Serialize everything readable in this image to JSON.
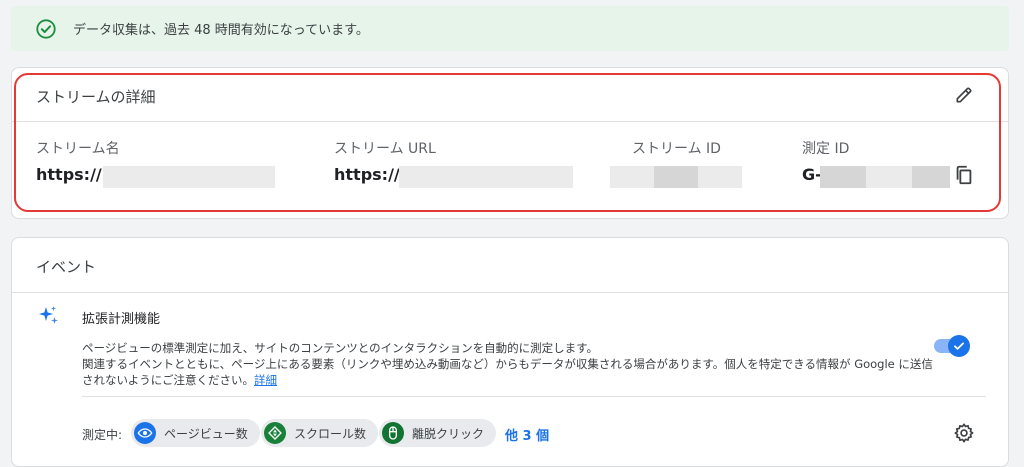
{
  "banner": {
    "message": "データ収集は、過去 48 時間有効になっています。",
    "icon": "check-circle-icon",
    "color": "#1e8e3e"
  },
  "stream_details": {
    "title": "ストリームの詳細",
    "edit_icon": "pencil-icon",
    "fields": {
      "name": {
        "label": "ストリーム名",
        "value": "https://"
      },
      "url": {
        "label": "ストリーム URL",
        "value": "https://"
      },
      "id": {
        "label": "ストリーム ID",
        "value": ""
      },
      "measurement_id": {
        "label": "測定 ID",
        "value": "G-"
      }
    },
    "copy_icon": "copy-icon",
    "highlight_color": "#e53935"
  },
  "events": {
    "title": "イベント",
    "enhanced": {
      "title": "拡張計測機能",
      "icon": "sparkle-icon",
      "description": "ページビューの標準測定に加え、サイトのコンテンツとのインタラクションを自動的に測定します。\n関連するイベントとともに、ページ上にある要素（リンクや埋め込み動画など）からもデータが収集される場合があります。個人を特定できる情報が Google に送信されないようにご注意ください。",
      "details_link": "詳細",
      "enabled": true
    },
    "measuring_label": "測定中:",
    "chips": [
      {
        "label": "ページビュー数",
        "icon": "eye-icon",
        "color": "#1a73e8"
      },
      {
        "label": "スクロール数",
        "icon": "scroll-diamond-icon",
        "color": "#188038"
      },
      {
        "label": "離脱クリック",
        "icon": "mouse-icon",
        "color": "#137333"
      }
    ],
    "more_label": "他 3 個",
    "settings_icon": "gear-icon"
  },
  "accent_color": "#1a73e8"
}
